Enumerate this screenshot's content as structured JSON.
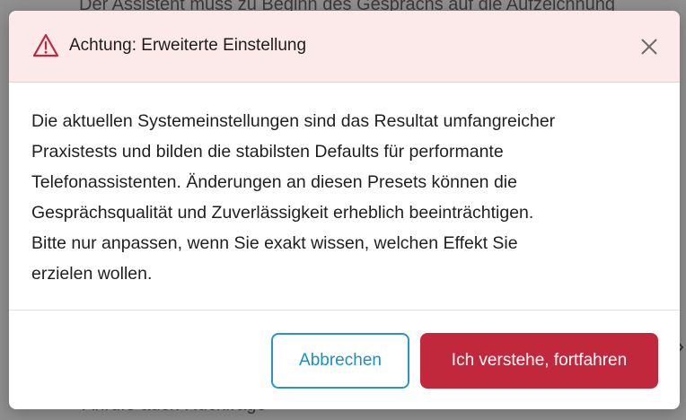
{
  "background": {
    "top_text": "Der Assistent muss zu Beginn des Gesprächs auf die Aufzeichnung",
    "bottom_text": "Anrufe auch Rückfrage"
  },
  "dialog": {
    "title": "Achtung: Erweiterte Einstellung",
    "lines": [
      "Die aktuellen Systemeinstellungen sind das Resultat umfangreicher",
      "Praxistests und bilden die stabilsten Defaults für performante",
      "Telefonassistenten. Änderungen an diesen Presets können die",
      "Gesprächsqualität und Zuverlässigkeit erheblich beeinträchtigen.",
      "Bitte nur anpassen, wenn Sie exakt wissen, welchen Effekt Sie",
      "erzielen wollen."
    ],
    "cancel_label": "Abbrechen",
    "confirm_label": "Ich verstehe, fortfahren"
  },
  "icons": {
    "warning": "warning-triangle-icon",
    "close": "close-icon"
  },
  "colors": {
    "header_bg": "#fce9ea",
    "warning_icon": "#c2283b",
    "cancel_border": "#2a95c8",
    "confirm_bg": "#c2283b"
  }
}
